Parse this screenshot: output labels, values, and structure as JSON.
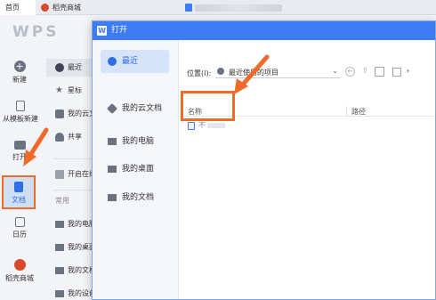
{
  "tabs": {
    "home": "首页",
    "shop": "稻壳商城"
  },
  "wps": {
    "logo": "WPS"
  },
  "leftbar": {
    "new": "新建",
    "template": "从模板新建",
    "open": "打开",
    "docs": "文档",
    "calendar": "日历",
    "shop": "稻壳商城"
  },
  "midcol": {
    "recent": "最近",
    "star": "星标",
    "cloud": "我的云文档",
    "share": "共享",
    "open_in": "开启在线...",
    "common": "常用",
    "pc": "我的电脑",
    "desktop": "我的桌面",
    "mydocs": "我的文档",
    "settings": "我的设备"
  },
  "dialog": {
    "title": "打开",
    "side": {
      "recent": "最近",
      "cloud": "我的云文档",
      "pc": "我的电脑",
      "desktop": "我的桌面",
      "mydocs": "我的文档"
    },
    "location_label": "位置(I):",
    "location_value": "最近使用的项目",
    "col_name": "名称",
    "col_path": "路径",
    "file_name": "不"
  },
  "colors": {
    "accent": "#3d7bf7",
    "annotation": "#f06a2a"
  }
}
